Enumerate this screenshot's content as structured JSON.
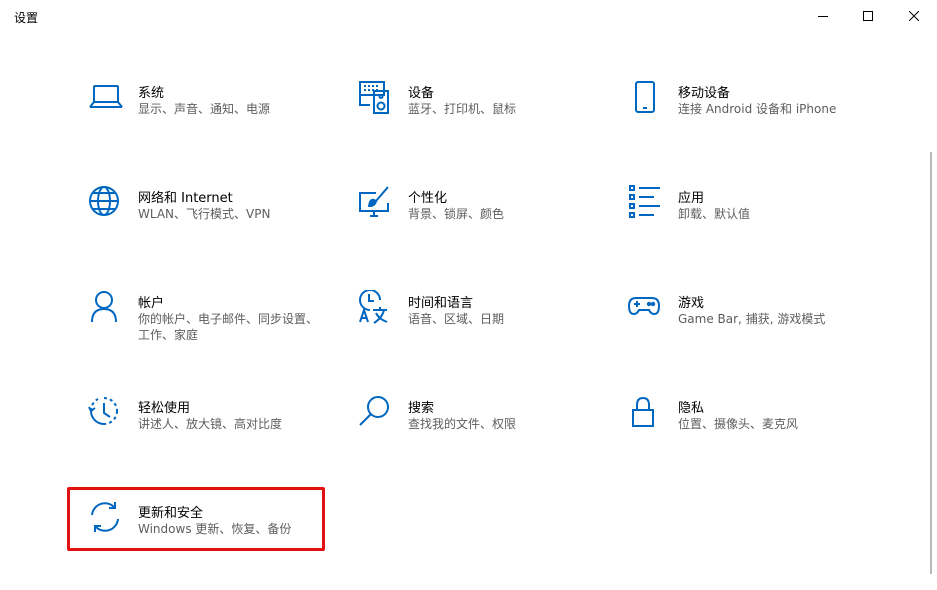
{
  "window": {
    "title": "设置",
    "controls": [
      "minimize",
      "maximize",
      "close"
    ]
  },
  "accent_color": "#0067c0",
  "highlight_color": "#e41111",
  "tiles": [
    {
      "name": "系统",
      "desc": "显示、声音、通知、电源",
      "icon": "laptop-icon"
    },
    {
      "name": "设备",
      "desc": "蓝牙、打印机、鼠标",
      "icon": "keyboard-speaker-icon"
    },
    {
      "name": "移动设备",
      "desc": "连接 Android 设备和 iPhone",
      "icon": "phone-icon"
    },
    {
      "name": "网络和 Internet",
      "desc": "WLAN、飞行模式、VPN",
      "icon": "globe-icon"
    },
    {
      "name": "个性化",
      "desc": "背景、锁屏、颜色",
      "icon": "paint-monitor-icon"
    },
    {
      "name": "应用",
      "desc": "卸载、默认值",
      "icon": "apps-list-icon"
    },
    {
      "name": "帐户",
      "desc": "你的帐户、电子邮件、同步设置、工作、家庭",
      "icon": "person-icon"
    },
    {
      "name": "时间和语言",
      "desc": "语音、区域、日期",
      "icon": "clock-language-icon"
    },
    {
      "name": "游戏",
      "desc": "Game Bar, 捕获, 游戏模式",
      "icon": "gamepad-icon"
    },
    {
      "name": "轻松使用",
      "desc": "讲述人、放大镜、高对比度",
      "icon": "ease-of-access-icon"
    },
    {
      "name": "搜索",
      "desc": "查找我的文件、权限",
      "icon": "search-icon"
    },
    {
      "name": "隐私",
      "desc": "位置、摄像头、麦克风",
      "icon": "lock-icon"
    },
    {
      "name": "更新和安全",
      "desc": "Windows 更新、恢复、备份",
      "icon": "sync-icon",
      "highlighted": true
    }
  ]
}
